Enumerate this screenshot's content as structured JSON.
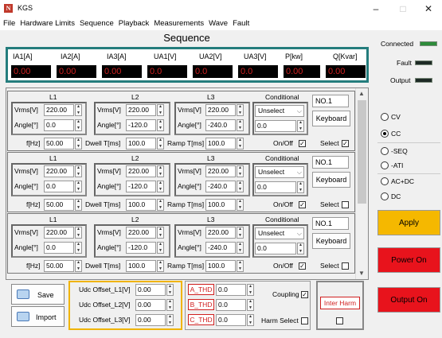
{
  "window": {
    "title": "KGS",
    "logo": "N",
    "min": "–",
    "max": "□",
    "close": "✕"
  },
  "menu": [
    "File",
    "Hardware Limits",
    "Sequence",
    "Playback",
    "Measurements",
    "Wave",
    "Fault"
  ],
  "sequence_title": "Sequence",
  "meters": [
    {
      "label": "IA1[A]",
      "value": "0.00"
    },
    {
      "label": "IA2[A]",
      "value": "0.00"
    },
    {
      "label": "IA3[A]",
      "value": "0.00"
    },
    {
      "label": "UA1[V]",
      "value": "0.0"
    },
    {
      "label": "UA2[V]",
      "value": "0.0"
    },
    {
      "label": "UA3[V]",
      "value": "0.0"
    },
    {
      "label": "P[kw]",
      "value": "0.00"
    },
    {
      "label": "Q[Kvar]",
      "value": "0.00"
    }
  ],
  "steps": [
    {
      "l1": "L1",
      "l2": "L2",
      "l3": "L3",
      "cond": "Conditional",
      "vrms_label": "Vrms[V]",
      "angle_label": "Angle[°]",
      "vrms1": "220.00",
      "angle1": "0.0",
      "vrms2": "220.00",
      "angle2": "-120.0",
      "vrms3": "220.00",
      "angle3": "-240.0",
      "fhz_label": "f[Hz]",
      "fhz": "50.00",
      "dwell_label": "Dwell T[ms]",
      "dwell": "100.0",
      "ramp_label": "Ramp T[ms]",
      "ramp": "100.0",
      "cond_select": "Unselect",
      "cond_value": "0.0",
      "onoff": "On/Off",
      "onoff_checked": true,
      "select": "Select",
      "select_checked": true,
      "no": "NO.1",
      "keyboard": "Keyboard"
    },
    {
      "l1": "L1",
      "l2": "L2",
      "l3": "L3",
      "cond": "Conditional",
      "vrms_label": "Vrms[V]",
      "angle_label": "Angle[°]",
      "vrms1": "220.00",
      "angle1": "0.0",
      "vrms2": "220.00",
      "angle2": "-120.0",
      "vrms3": "220.00",
      "angle3": "-240.0",
      "fhz_label": "f[Hz]",
      "fhz": "50.00",
      "dwell_label": "Dwell T[ms]",
      "dwell": "100.0",
      "ramp_label": "Ramp T[ms]",
      "ramp": "100.0",
      "cond_select": "Unselect",
      "cond_value": "0.0",
      "onoff": "On/Off",
      "onoff_checked": true,
      "select": "Select",
      "select_checked": false,
      "no": "NO.1",
      "keyboard": "Keyboard"
    },
    {
      "l1": "L1",
      "l2": "L2",
      "l3": "L3",
      "cond": "Conditional",
      "vrms_label": "Vrms[V]",
      "angle_label": "Angle[°]",
      "vrms1": "220.00",
      "angle1": "0.0",
      "vrms2": "220.00",
      "angle2": "-120.0",
      "vrms3": "220.00",
      "angle3": "-240.0",
      "fhz_label": "f[Hz]",
      "fhz": "50.00",
      "dwell_label": "Dwell T[ms]",
      "dwell": "100.0",
      "ramp_label": "Ramp T[ms]",
      "ramp": "100.0",
      "cond_select": "Unselect",
      "cond_value": "0.0",
      "onoff": "On/Off",
      "onoff_checked": true,
      "select": "Select",
      "select_checked": false,
      "no": "NO.1",
      "keyboard": "Keyboard"
    }
  ],
  "bottom": {
    "save": "Save",
    "import": "Import",
    "udc1_label": "Udc Offset_L1[V]",
    "udc1": "0.00",
    "udc2_label": "Udc Offset_L2[V]",
    "udc2": "0.00",
    "udc3_label": "Udc Offset_L3[V]",
    "udc3": "0.00",
    "athd": "A_THD",
    "athd_v": "0.0",
    "bthd": "B_THD",
    "bthd_v": "0.0",
    "cthd": "C_THD",
    "cthd_v": "0.0",
    "coupling": "Coupling",
    "harm_select": "Harm Select",
    "inter_harm": "Inter Harm"
  },
  "status": {
    "connected": "Connected",
    "fault": "Fault",
    "output": "Output"
  },
  "modes": [
    "CV",
    "CC",
    "-SEQ",
    "-ATI",
    "AC+DC",
    "DC"
  ],
  "selected_mode": "CC",
  "apply": "Apply",
  "power_on": "Power On",
  "output_on": "Output On",
  "colors": {
    "accent_teal": "#247d7d",
    "apply": "#f5b800",
    "red_btn": "#e8131c",
    "meter_text": "#d02020",
    "highlight_border": "#f0b400"
  }
}
